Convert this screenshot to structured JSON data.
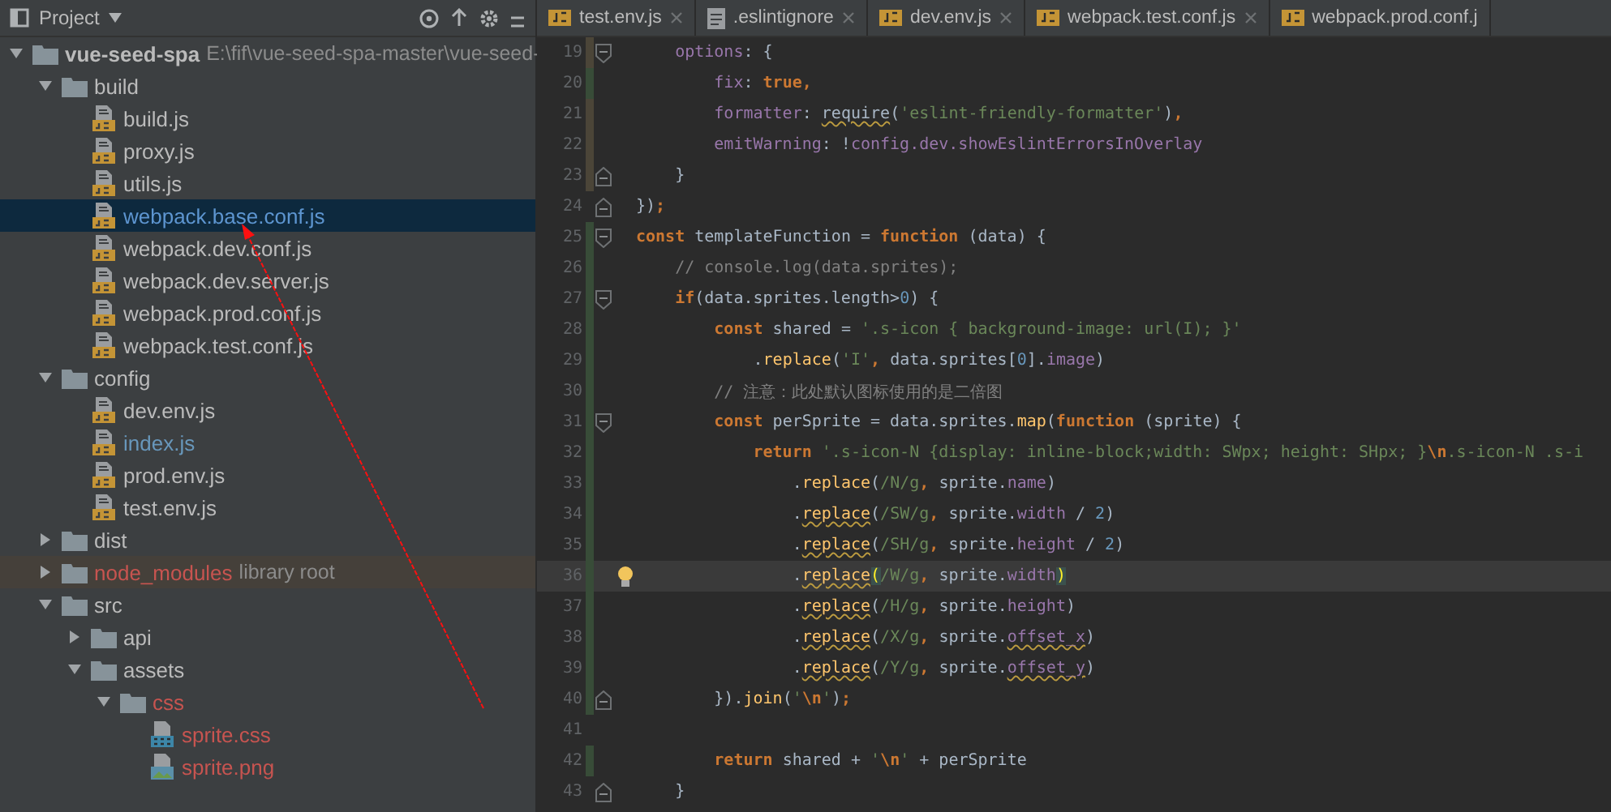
{
  "project_panel": {
    "title": "Project",
    "tree": [
      {
        "name": "vue-seed-spa",
        "path": "E:\\fif\\vue-seed-spa-master\\vue-seed-",
        "kind": "module",
        "expanded": true,
        "selected": false,
        "children": [
          {
            "name": "build",
            "kind": "folder",
            "expanded": true,
            "selected": false,
            "children": [
              {
                "name": "build.js",
                "kind": "js",
                "selected": false
              },
              {
                "name": "proxy.js",
                "kind": "js",
                "selected": false
              },
              {
                "name": "utils.js",
                "kind": "js",
                "selected": false
              },
              {
                "name": "webpack.base.conf.js",
                "kind": "js",
                "selected": true
              },
              {
                "name": "webpack.dev.conf.js",
                "kind": "js",
                "selected": false
              },
              {
                "name": "webpack.dev.server.js",
                "kind": "js",
                "selected": false
              },
              {
                "name": "webpack.prod.conf.js",
                "kind": "js",
                "selected": false
              },
              {
                "name": "webpack.test.conf.js",
                "kind": "js",
                "selected": false
              }
            ]
          },
          {
            "name": "config",
            "kind": "folder",
            "expanded": true,
            "selected": false,
            "children": [
              {
                "name": "dev.env.js",
                "kind": "js",
                "selected": false
              },
              {
                "name": "index.js",
                "kind": "js",
                "selected": false,
                "color": "#6897bb"
              },
              {
                "name": "prod.env.js",
                "kind": "js",
                "selected": false
              },
              {
                "name": "test.env.js",
                "kind": "js",
                "selected": false
              }
            ]
          },
          {
            "name": "dist",
            "kind": "folder",
            "expanded": false,
            "selected": false
          },
          {
            "name": "node_modules",
            "suffix": "library root",
            "kind": "folder",
            "expanded": false,
            "selected": false,
            "color": "#c75450"
          },
          {
            "name": "src",
            "kind": "folder",
            "expanded": true,
            "selected": false,
            "children": [
              {
                "name": "api",
                "kind": "folder",
                "expanded": false,
                "selected": false
              },
              {
                "name": "assets",
                "kind": "folder",
                "expanded": true,
                "selected": false,
                "children": [
                  {
                    "name": "css",
                    "kind": "folder",
                    "expanded": true,
                    "selected": false,
                    "color": "#c75450",
                    "children": [
                      {
                        "name": "sprite.css",
                        "kind": "css",
                        "selected": false,
                        "color": "#c75450"
                      },
                      {
                        "name": "sprite.png",
                        "kind": "png",
                        "selected": false,
                        "color": "#c75450"
                      }
                    ]
                  }
                ]
              }
            ]
          }
        ]
      }
    ]
  },
  "editor": {
    "tabs": [
      {
        "label": "test.env.js",
        "kind": "js",
        "selected": false,
        "closable": true
      },
      {
        "label": ".eslintignore",
        "kind": "text",
        "selected": false,
        "closable": true
      },
      {
        "label": "dev.env.js",
        "kind": "js",
        "selected": false,
        "closable": true
      },
      {
        "label": "webpack.test.conf.js",
        "kind": "js",
        "selected": false,
        "closable": true
      },
      {
        "label": "webpack.prod.conf.j",
        "kind": "js",
        "selected": false,
        "closable": false
      }
    ],
    "lines": [
      {
        "number": "19",
        "color": "#4b4538",
        "fold_start": true,
        "fold_end": false,
        "current": false,
        "bulb": false,
        "tokens": [
          {
            "text": "    options",
            "kind": "prop"
          },
          {
            "text": ": {",
            "kind": "plain"
          }
        ]
      },
      {
        "number": "20",
        "color": "#384c38",
        "fold_start": false,
        "fold_end": false,
        "current": false,
        "bulb": false,
        "tokens": [
          {
            "text": "        fix",
            "kind": "prop"
          },
          {
            "text": ": ",
            "kind": "plain"
          },
          {
            "text": "true",
            "kind": "kw"
          },
          {
            "text": ",",
            "kind": "kw"
          }
        ]
      },
      {
        "number": "21",
        "color": "#4b4538",
        "fold_start": false,
        "fold_end": false,
        "current": false,
        "bulb": false,
        "tokens": [
          {
            "text": "        formatter",
            "kind": "prop"
          },
          {
            "text": ": ",
            "kind": "plain"
          },
          {
            "text": "require",
            "kind": "plain",
            "warn": true
          },
          {
            "text": "(",
            "kind": "plain"
          },
          {
            "text": "'eslint-friendly-formatter'",
            "kind": "str"
          },
          {
            "text": ")",
            "kind": "plain"
          },
          {
            "text": ",",
            "kind": "kw"
          }
        ]
      },
      {
        "number": "22",
        "color": "#4b4538",
        "fold_start": false,
        "fold_end": false,
        "current": false,
        "bulb": false,
        "tokens": [
          {
            "text": "        emitWarning",
            "kind": "prop"
          },
          {
            "text": ": !",
            "kind": "plain"
          },
          {
            "text": "config.dev.showEslintErrorsInOverlay",
            "kind": "prop"
          }
        ]
      },
      {
        "number": "23",
        "color": "#4b4538",
        "fold_start": false,
        "fold_end": true,
        "current": false,
        "bulb": false,
        "tokens": [
          {
            "text": "    }",
            "kind": "plain"
          }
        ]
      },
      {
        "number": "24",
        "fold_start": false,
        "fold_end": true,
        "current": false,
        "bulb": false,
        "tokens": [
          {
            "text": "})",
            "kind": "plain"
          },
          {
            "text": ";",
            "kind": "kw"
          }
        ]
      },
      {
        "number": "25",
        "color": "#384c38",
        "fold_start": true,
        "fold_end": false,
        "current": false,
        "bulb": false,
        "tokens": [
          {
            "text": "const",
            "kind": "kw"
          },
          {
            "text": " templateFunction = ",
            "kind": "plain"
          },
          {
            "text": "function",
            "kind": "kw"
          },
          {
            "text": " (data) {",
            "kind": "plain"
          }
        ]
      },
      {
        "number": "26",
        "color": "#384c38",
        "fold_start": false,
        "fold_end": false,
        "current": false,
        "bulb": false,
        "tokens": [
          {
            "text": "    // console.log(data.sprites);",
            "kind": "comment"
          }
        ]
      },
      {
        "number": "27",
        "color": "#384c38",
        "fold_start": true,
        "fold_end": false,
        "current": false,
        "bulb": false,
        "tokens": [
          {
            "text": "    if",
            "kind": "kw"
          },
          {
            "text": "(data.sprites.length>",
            "kind": "plain"
          },
          {
            "text": "0",
            "kind": "num"
          },
          {
            "text": ") {",
            "kind": "plain"
          }
        ]
      },
      {
        "number": "28",
        "color": "#384c38",
        "fold_start": false,
        "fold_end": false,
        "current": false,
        "bulb": false,
        "tokens": [
          {
            "text": "        const",
            "kind": "kw"
          },
          {
            "text": " shared = ",
            "kind": "plain"
          },
          {
            "text": "'.s-icon { background-image: url(I); }'",
            "kind": "str"
          }
        ]
      },
      {
        "number": "29",
        "color": "#384c38",
        "fold_start": false,
        "fold_end": false,
        "current": false,
        "bulb": false,
        "tokens": [
          {
            "text": "            .",
            "kind": "plain"
          },
          {
            "text": "replace",
            "kind": "fn"
          },
          {
            "text": "(",
            "kind": "plain"
          },
          {
            "text": "'I'",
            "kind": "str"
          },
          {
            "text": ",",
            "kind": "kw"
          },
          {
            "text": " data.sprites[",
            "kind": "plain"
          },
          {
            "text": "0",
            "kind": "num"
          },
          {
            "text": "].",
            "kind": "plain"
          },
          {
            "text": "image",
            "kind": "prop"
          },
          {
            "text": ")",
            "kind": "plain"
          }
        ]
      },
      {
        "number": "30",
        "color": "#384c38",
        "fold_start": false,
        "fold_end": false,
        "current": false,
        "bulb": false,
        "tokens": [
          {
            "text": "        // 注意：此处默认图标使用的是二倍图",
            "kind": "comment"
          }
        ]
      },
      {
        "number": "31",
        "color": "#384c38",
        "fold_start": true,
        "fold_end": false,
        "current": false,
        "bulb": false,
        "tokens": [
          {
            "text": "        const",
            "kind": "kw"
          },
          {
            "text": " perSprite = data.sprites.",
            "kind": "plain"
          },
          {
            "text": "map",
            "kind": "fn"
          },
          {
            "text": "(",
            "kind": "plain"
          },
          {
            "text": "function",
            "kind": "kw"
          },
          {
            "text": " (sprite) {",
            "kind": "plain"
          }
        ]
      },
      {
        "number": "32",
        "color": "#384c38",
        "fold_start": false,
        "fold_end": false,
        "current": false,
        "bulb": false,
        "tokens": [
          {
            "text": "            return",
            "kind": "kw"
          },
          {
            "text": " '.s-icon-N {display: inline-block;width: SWpx; height: SHpx; }",
            "kind": "str"
          },
          {
            "text": "\\n",
            "kind": "kw"
          },
          {
            "text": ".s-icon-N .s-i",
            "kind": "str"
          }
        ]
      },
      {
        "number": "33",
        "color": "#384c38",
        "fold_start": false,
        "fold_end": false,
        "current": false,
        "bulb": false,
        "tokens": [
          {
            "text": "                .",
            "kind": "plain"
          },
          {
            "text": "replace",
            "kind": "fn"
          },
          {
            "text": "(",
            "kind": "plain"
          },
          {
            "text": "/N/g",
            "kind": "str"
          },
          {
            "text": ",",
            "kind": "kw"
          },
          {
            "text": " sprite.",
            "kind": "plain"
          },
          {
            "text": "name",
            "kind": "prop"
          },
          {
            "text": ")",
            "kind": "plain"
          }
        ]
      },
      {
        "number": "34",
        "color": "#384c38",
        "fold_start": false,
        "fold_end": false,
        "current": false,
        "bulb": false,
        "tokens": [
          {
            "text": "                .",
            "kind": "plain"
          },
          {
            "text": "replace",
            "kind": "fn",
            "warn": true
          },
          {
            "text": "(",
            "kind": "plain"
          },
          {
            "text": "/SW/g",
            "kind": "str"
          },
          {
            "text": ",",
            "kind": "kw"
          },
          {
            "text": " sprite.",
            "kind": "plain"
          },
          {
            "text": "width",
            "kind": "prop"
          },
          {
            "text": " / ",
            "kind": "plain"
          },
          {
            "text": "2",
            "kind": "num"
          },
          {
            "text": ")",
            "kind": "plain"
          }
        ]
      },
      {
        "number": "35",
        "color": "#384c38",
        "fold_start": false,
        "fold_end": false,
        "current": false,
        "bulb": false,
        "tokens": [
          {
            "text": "                .",
            "kind": "plain"
          },
          {
            "text": "replace",
            "kind": "fn",
            "warn": true
          },
          {
            "text": "(",
            "kind": "plain"
          },
          {
            "text": "/SH/g",
            "kind": "str"
          },
          {
            "text": ",",
            "kind": "kw"
          },
          {
            "text": " sprite.",
            "kind": "plain"
          },
          {
            "text": "height",
            "kind": "prop"
          },
          {
            "text": " / ",
            "kind": "plain"
          },
          {
            "text": "2",
            "kind": "num"
          },
          {
            "text": ")",
            "kind": "plain"
          }
        ]
      },
      {
        "number": "36",
        "color": "#384c38",
        "fold_start": false,
        "fold_end": false,
        "current": true,
        "bulb": true,
        "tokens": [
          {
            "text": "                .",
            "kind": "plain"
          },
          {
            "text": "replace",
            "kind": "fn",
            "warn": true
          },
          {
            "text": "(",
            "kind": "match"
          },
          {
            "text": "/W/g",
            "kind": "str"
          },
          {
            "text": ",",
            "kind": "kw"
          },
          {
            "text": " sprite.",
            "kind": "plain"
          },
          {
            "text": "width",
            "kind": "prop"
          },
          {
            "text": ")",
            "kind": "match"
          }
        ]
      },
      {
        "number": "37",
        "color": "#384c38",
        "fold_start": false,
        "fold_end": false,
        "current": false,
        "bulb": false,
        "tokens": [
          {
            "text": "                .",
            "kind": "plain"
          },
          {
            "text": "replace",
            "kind": "fn",
            "warn": true
          },
          {
            "text": "(",
            "kind": "plain"
          },
          {
            "text": "/H/g",
            "kind": "str"
          },
          {
            "text": ",",
            "kind": "kw"
          },
          {
            "text": " sprite.",
            "kind": "plain"
          },
          {
            "text": "height",
            "kind": "prop"
          },
          {
            "text": ")",
            "kind": "plain"
          }
        ]
      },
      {
        "number": "38",
        "color": "#384c38",
        "fold_start": false,
        "fold_end": false,
        "current": false,
        "bulb": false,
        "tokens": [
          {
            "text": "                .",
            "kind": "plain"
          },
          {
            "text": "replace",
            "kind": "fn",
            "warn": true
          },
          {
            "text": "(",
            "kind": "plain"
          },
          {
            "text": "/X/g",
            "kind": "str"
          },
          {
            "text": ",",
            "kind": "kw"
          },
          {
            "text": " sprite.",
            "kind": "plain"
          },
          {
            "text": "offset_x",
            "kind": "prop",
            "warn": true
          },
          {
            "text": ")",
            "kind": "plain"
          }
        ]
      },
      {
        "number": "39",
        "color": "#384c38",
        "fold_start": false,
        "fold_end": false,
        "current": false,
        "bulb": false,
        "tokens": [
          {
            "text": "                .",
            "kind": "plain"
          },
          {
            "text": "replace",
            "kind": "fn",
            "warn": true
          },
          {
            "text": "(",
            "kind": "plain"
          },
          {
            "text": "/Y/g",
            "kind": "str"
          },
          {
            "text": ",",
            "kind": "kw"
          },
          {
            "text": " sprite.",
            "kind": "plain"
          },
          {
            "text": "offset_y",
            "kind": "prop",
            "warn": true
          },
          {
            "text": ")",
            "kind": "plain"
          }
        ]
      },
      {
        "number": "40",
        "color": "#384c38",
        "fold_start": false,
        "fold_end": true,
        "current": false,
        "bulb": false,
        "tokens": [
          {
            "text": "        }).",
            "kind": "plain"
          },
          {
            "text": "join",
            "kind": "fn"
          },
          {
            "text": "(",
            "kind": "plain"
          },
          {
            "text": "'",
            "kind": "str"
          },
          {
            "text": "\\n",
            "kind": "kw"
          },
          {
            "text": "'",
            "kind": "str"
          },
          {
            "text": ")",
            "kind": "plain"
          },
          {
            "text": ";",
            "kind": "kw"
          }
        ]
      },
      {
        "number": "41",
        "fold_start": false,
        "fold_end": false,
        "current": false,
        "bulb": false
      },
      {
        "number": "42",
        "color": "#384c38",
        "fold_start": false,
        "fold_end": false,
        "current": false,
        "bulb": false,
        "tokens": [
          {
            "text": "        return",
            "kind": "kw"
          },
          {
            "text": " shared + ",
            "kind": "plain"
          },
          {
            "text": "'",
            "kind": "str"
          },
          {
            "text": "\\n",
            "kind": "kw"
          },
          {
            "text": "'",
            "kind": "str"
          },
          {
            "text": " + perSprite",
            "kind": "plain"
          }
        ]
      },
      {
        "number": "43",
        "fold_start": false,
        "fold_end": true,
        "current": false,
        "bulb": false,
        "tokens": [
          {
            "text": "    }",
            "kind": "plain"
          }
        ]
      }
    ]
  }
}
